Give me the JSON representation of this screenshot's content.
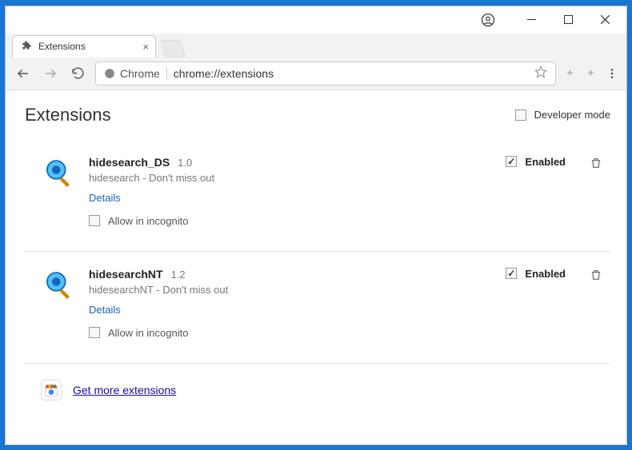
{
  "window": {
    "tab_title": "Extensions",
    "omnibox_scheme_label": "Chrome",
    "omnibox_url": "chrome://extensions"
  },
  "page": {
    "title": "Extensions",
    "developer_mode_label": "Developer mode",
    "enabled_label": "Enabled",
    "details_label": "Details",
    "allow_incognito_label": "Allow in incognito",
    "get_more_label": "Get more extensions"
  },
  "extensions": [
    {
      "name": "hidesearch_DS",
      "version": "1.0",
      "description": "hidesearch - Don't miss out",
      "enabled": true
    },
    {
      "name": "hidesearchNT",
      "version": "1.2",
      "description": "hidesearchNT - Don't miss out",
      "enabled": true
    }
  ]
}
